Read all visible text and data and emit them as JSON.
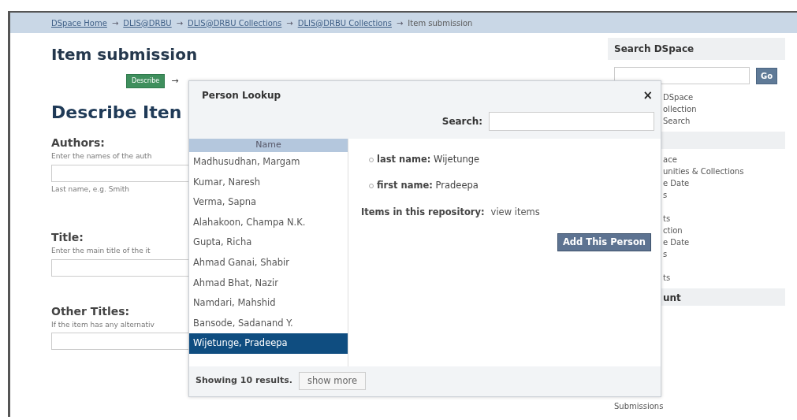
{
  "breadcrumb": [
    {
      "label": "DSpace Home",
      "link": true
    },
    {
      "label": "DLIS@DRBU",
      "link": true
    },
    {
      "label": "DLIS@DRBU Collections",
      "link": true
    },
    {
      "label": "DLIS@DRBU Collections",
      "link": true
    },
    {
      "label": "Item submission",
      "link": false
    }
  ],
  "breadcrumb_separator": "→",
  "page_title": "Item submission",
  "steps": [
    {
      "label": "Describe",
      "selected": true
    }
  ],
  "step_arrow": "→",
  "section_title": "Describe Iten",
  "fields": [
    {
      "label": "Authors:",
      "hint": "Enter the names of the auth",
      "note": "Last name, e.g. Smith"
    },
    {
      "label": "Title:",
      "hint": "Enter the main title of the it"
    },
    {
      "label": "Other Titles:",
      "hint": "If the item has any alternativ"
    }
  ],
  "sidebar": {
    "search_title": "Search DSpace",
    "go": "Go",
    "blocks": [
      {
        "kind": "text",
        "text": "DSpace"
      },
      {
        "kind": "text",
        "text": "ollection"
      },
      {
        "kind": "link",
        "text": "Search"
      },
      {
        "kind": "header"
      },
      {
        "kind": "text",
        "text": "ace"
      },
      {
        "kind": "link",
        "text": "unities & Collections"
      },
      {
        "kind": "link",
        "text": "e Date"
      },
      {
        "kind": "link",
        "text": "s"
      },
      {
        "kind": "gap"
      },
      {
        "kind": "link",
        "text": "ts"
      },
      {
        "kind": "text",
        "text": "ction"
      },
      {
        "kind": "link",
        "text": "e Date"
      },
      {
        "kind": "link",
        "text": "s"
      },
      {
        "kind": "gap"
      },
      {
        "kind": "link",
        "text": "ts"
      },
      {
        "kind": "header",
        "text": "unt"
      },
      {
        "kind": "gap"
      },
      {
        "kind": "gap"
      },
      {
        "kind": "fulllink",
        "text": "Submissions"
      }
    ]
  },
  "dialog": {
    "title": "Person Lookup",
    "close": "×",
    "search_label": "Search:",
    "list_header": "Name",
    "results": [
      {
        "name": "Madhusudhan, Margam",
        "selected": false
      },
      {
        "name": "Kumar, Naresh",
        "selected": false
      },
      {
        "name": "Verma, Sapna",
        "selected": false
      },
      {
        "name": "Alahakoon, Champa N.K.",
        "selected": false
      },
      {
        "name": "Gupta, Richa",
        "selected": false
      },
      {
        "name": "Ahmad Ganai, Shabir",
        "selected": false
      },
      {
        "name": "Ahmad Bhat, Nazir",
        "selected": false
      },
      {
        "name": "Namdari, Mahshid",
        "selected": false
      },
      {
        "name": "Bansode, Sadanand Y.",
        "selected": false
      },
      {
        "name": "Wijetunge, Pradeepa",
        "selected": true
      }
    ],
    "details": [
      {
        "label": "last name:",
        "value": "Wijetunge"
      },
      {
        "label": "first name:",
        "value": "Pradeepa"
      }
    ],
    "items_label": "Items in this repository:",
    "items_link": "view items",
    "add_button": "Add This Person",
    "footer_text": "Showing 10 results.",
    "more_button": "show more"
  }
}
